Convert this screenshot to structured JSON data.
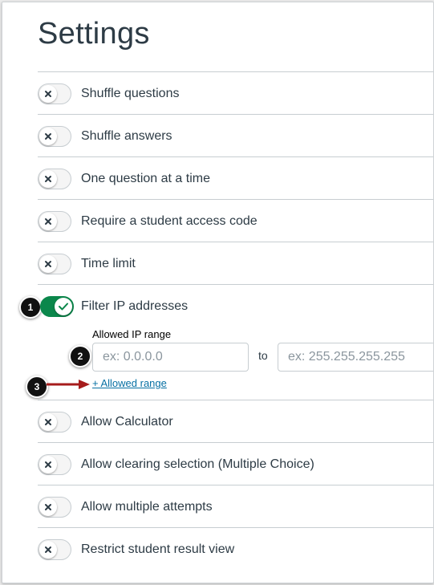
{
  "page": {
    "title": "Settings"
  },
  "settings": [
    {
      "label": "Shuffle questions",
      "on": false
    },
    {
      "label": "Shuffle answers",
      "on": false
    },
    {
      "label": "One question at a time",
      "on": false
    },
    {
      "label": "Require a student access code",
      "on": false
    },
    {
      "label": "Time limit",
      "on": false
    },
    {
      "label": "Filter IP addresses",
      "on": true
    },
    {
      "label": "Allow Calculator",
      "on": false
    },
    {
      "label": "Allow clearing selection (Multiple Choice)",
      "on": false
    },
    {
      "label": "Allow multiple attempts",
      "on": false
    },
    {
      "label": "Restrict student result view",
      "on": false
    }
  ],
  "ip_filter": {
    "range_label": "Allowed IP range",
    "from_placeholder": "ex: 0.0.0.0",
    "to_label": "to",
    "to_placeholder": "ex: 255.255.255.255",
    "add_range_link": "+ Allowed range"
  },
  "callouts": [
    "1",
    "2",
    "3"
  ],
  "colors": {
    "toggle_on": "#0b874b",
    "link": "#0770a3",
    "arrow": "#a61c1c",
    "text": "#2d3b45"
  },
  "icons": {
    "toggle_off": "x-icon",
    "toggle_on": "check-icon"
  }
}
